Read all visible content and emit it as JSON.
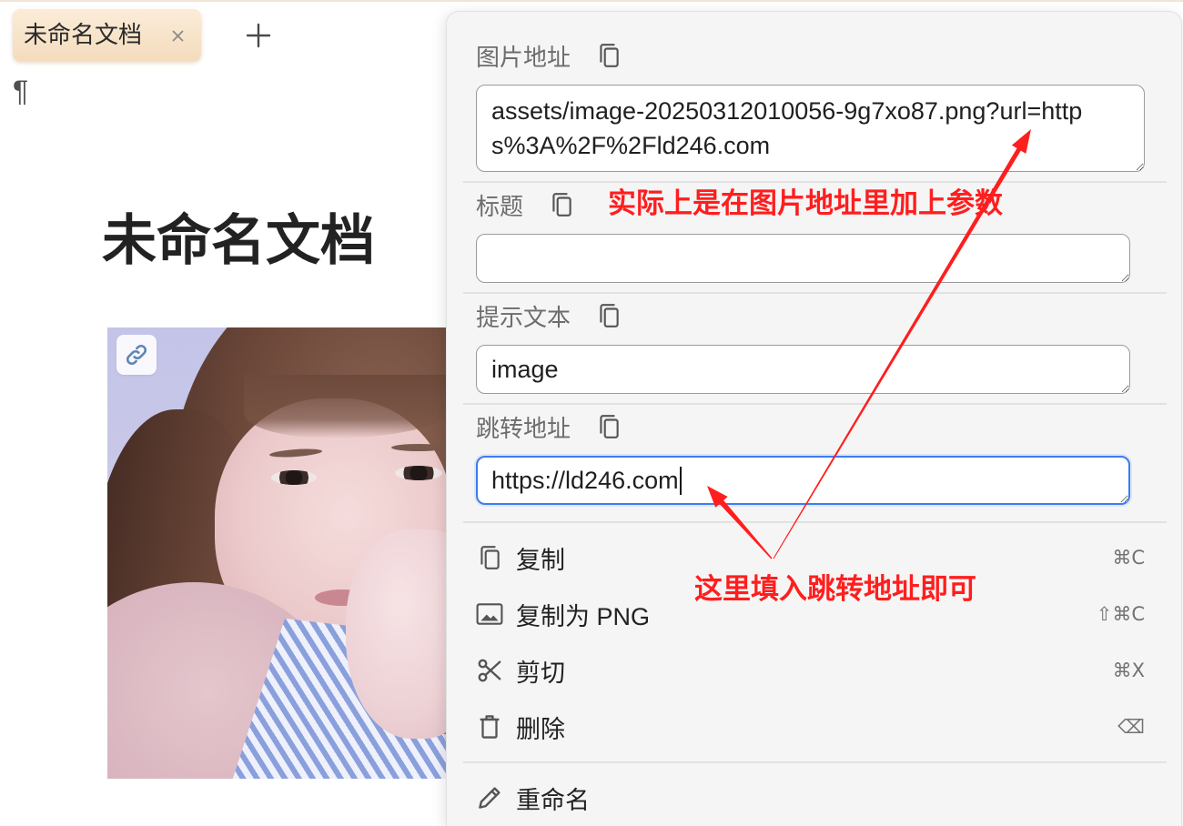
{
  "tabs": [
    {
      "label": "未命名文档",
      "close_icon": "close-icon"
    }
  ],
  "new_tab_icon": "plus-icon",
  "editor": {
    "block_icon": "¶",
    "title": "未命名文档",
    "image": {
      "badge_icon": "link-icon"
    }
  },
  "image_menu": {
    "fields": {
      "url": {
        "label": "图片地址",
        "value": "assets/image-20250312010056-9g7xo87.png?url=https%3A%2F%2Fld246.com",
        "icon": "copy-icon"
      },
      "title": {
        "label": "标题",
        "value": "",
        "icon": "copy-icon"
      },
      "alt": {
        "label": "提示文本",
        "value": "image",
        "icon": "copy-icon"
      },
      "link": {
        "label": "跳转地址",
        "value": "https://ld246.com",
        "icon": "copy-icon",
        "focused": true
      }
    },
    "items": [
      {
        "label": "复制",
        "shortcut": "⌘C",
        "icon": "copy-icon"
      },
      {
        "label": "复制为 PNG",
        "shortcut": "⇧⌘C",
        "icon": "image-icon"
      },
      {
        "label": "剪切",
        "shortcut": "⌘X",
        "icon": "scissors-icon"
      },
      {
        "label": "删除",
        "shortcut": "⌫",
        "icon": "trash-icon"
      },
      {
        "label": "重命名",
        "icon": "pencil-icon"
      }
    ]
  },
  "annotations": {
    "color": "#ff1e1e",
    "url_note": "实际上是在图片地址里加上参数",
    "link_note": "这里填入跳转地址即可"
  },
  "theme": {
    "accent": "#3d7cf0",
    "tab_background": "#f4dcbc",
    "panel_background": "#f5f5f5"
  }
}
